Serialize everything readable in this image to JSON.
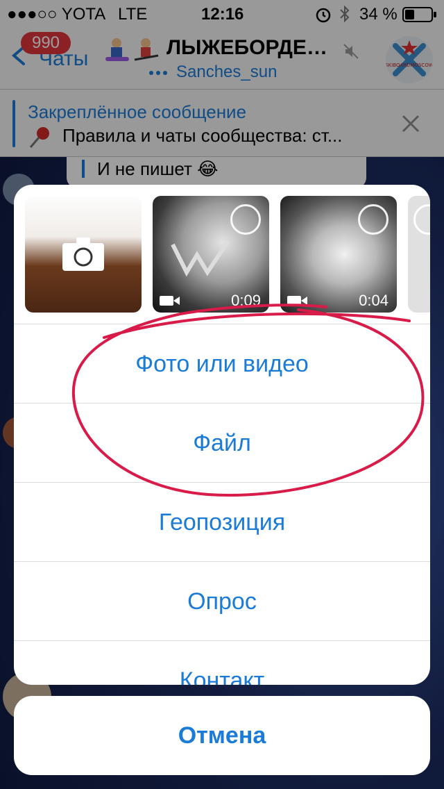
{
  "status": {
    "carrier": "●●●○○ YOTA",
    "network": "LTE",
    "time": "12:16",
    "battery": "34 %"
  },
  "nav": {
    "badge": "990",
    "back_label": "Чаты",
    "title": "ЛЫЖЕБОРДЕ…",
    "subtitle": "Sanches_sun",
    "avatar_text": "SKIBOARDMOSCOW"
  },
  "pinned": {
    "title": "Закреплённое сообщение",
    "text": "Правила и чаты сообщества: ст..."
  },
  "bubble": {
    "text": "И не пишет 😂"
  },
  "thumbnails": [
    {
      "kind": "camera"
    },
    {
      "kind": "video",
      "duration": "0:09"
    },
    {
      "kind": "video",
      "duration": "0:04"
    }
  ],
  "sheet": {
    "items": [
      "Фото или видео",
      "Файл",
      "Геопозиция",
      "Опрос",
      "Контакт"
    ],
    "cancel": "Отмена"
  },
  "colors": {
    "accent": "#1b7bd8",
    "annotation": "#d81b48",
    "badge": "#e0343c"
  }
}
